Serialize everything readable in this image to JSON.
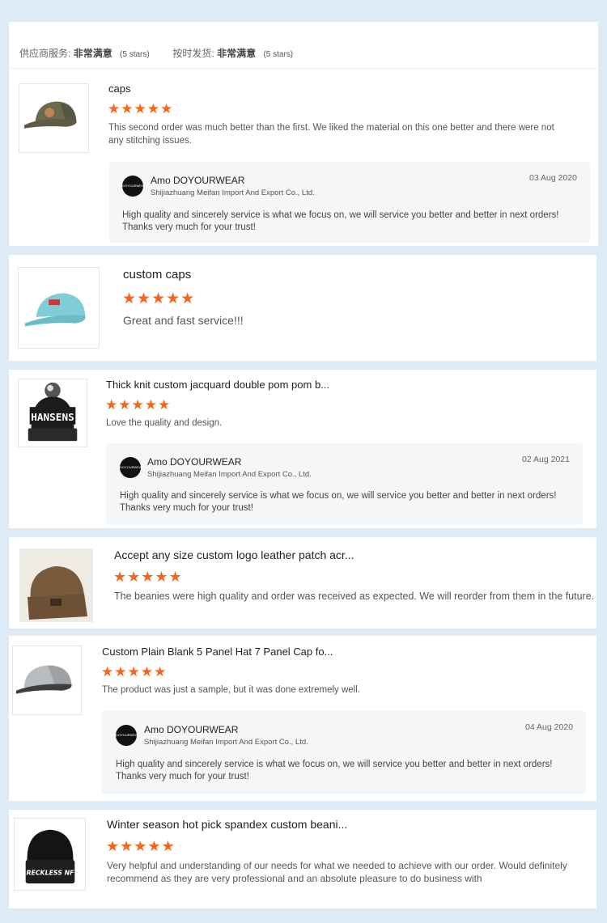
{
  "summary": {
    "supplier_label": "供应商服务:",
    "supplier_value": "非常满意",
    "supplier_stars": "(5 stars)",
    "ship_label": "按时发货:",
    "ship_value": "非常满意",
    "ship_stars": "(5 stars)"
  },
  "stars_text": "★★★★★",
  "reviews": [
    {
      "title": "caps",
      "rating": 5,
      "text": "This second order was much better than the first. We liked the material on this one better and there were not any stitching issues.",
      "reply": {
        "name": "Amo DOYOURWEAR",
        "company": "Shijiazhuang Meifan Import And Export Co., Ltd.",
        "date": "03 Aug 2020",
        "text": "High quality and sincerely service is what we focus on, we will service you better and better in next orders! Thanks very much for your trust!"
      }
    },
    {
      "title": "custom caps",
      "rating": 5,
      "text": "Great and fast service!!!"
    },
    {
      "title": "Thick knit custom jacquard double pom pom b...",
      "rating": 5,
      "text": "Love the quality and design.",
      "reply": {
        "name": "Amo DOYOURWEAR",
        "company": "Shijiazhuang Meifan Import And Export Co., Ltd.",
        "date": "02 Aug 2021",
        "text": "High quality and sincerely service is what we focus on, we will service you better and better in next orders! Thanks very much for your trust!"
      }
    },
    {
      "title": "Accept any size custom logo leather patch acr...",
      "rating": 5,
      "text": "The beanies were high quality and order was received as expected. We will reorder from them in the future."
    },
    {
      "title": "Custom Plain Blank 5 Panel Hat 7 Panel Cap fo...",
      "rating": 5,
      "text": "The product was just a sample, but it was done extremely well.",
      "reply": {
        "name": "Amo DOYOURWEAR",
        "company": "Shijiazhuang Meifan Import And Export Co., Ltd.",
        "date": "04 Aug 2020",
        "text": "High quality and sincerely service is what we focus on, we will service you better and better in next orders! Thanks very much for your trust!"
      }
    },
    {
      "title": "Winter season hot pick spandex custom beani...",
      "rating": 5,
      "text": "Very helpful and understanding of our needs for what we needed to achieve with our order.  Would definitely recommend as they are very professional and an absolute pleasure to do business with"
    }
  ],
  "logo_text": "DOYOURWEAR",
  "hat_labels": {
    "pom_beanie": "HANSENS",
    "black_beanie": "RECKLESS NF"
  },
  "colors": {
    "star": "#f4651e",
    "background": "#dcebf5",
    "reply_bg": "#f5f6f7"
  }
}
